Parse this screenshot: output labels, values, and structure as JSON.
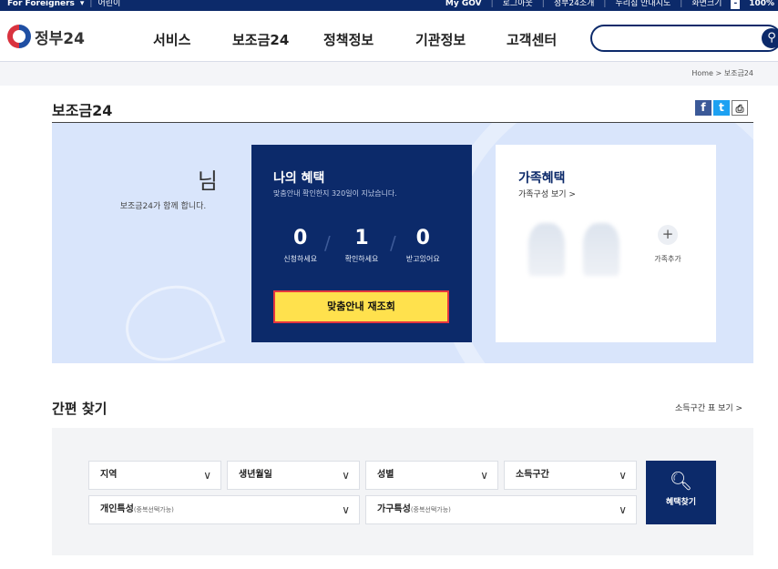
{
  "topbar": {
    "foreigners": "For Foreigners",
    "language": "어린이",
    "links": [
      "My GOV",
      "로그아웃",
      "정부24소개",
      "누리집 안내지도",
      "화면크기"
    ],
    "zoom": "100%"
  },
  "header": {
    "logo_text": "정부24",
    "nav": [
      "서비스",
      "보조금24",
      "정책정보",
      "기관정보",
      "고객센터"
    ],
    "search_placeholder": ""
  },
  "breadcrumb": "Home > 보조금24",
  "page": {
    "title": "보조금24"
  },
  "greeting": {
    "name_suffix": "님",
    "subtitle": "보조금24가 함께 합니다."
  },
  "my_benefits": {
    "title": "나의 혜택",
    "info": "맞춤안내 확인한지 320일이 지났습니다.",
    "counts": [
      {
        "value": "0",
        "label": "신청하세요"
      },
      {
        "value": "1",
        "label": "확인하세요"
      },
      {
        "value": "0",
        "label": "받고있어요"
      }
    ],
    "recheck_label": "맞춤안내 재조회"
  },
  "family": {
    "title": "가족혜택",
    "link": "가족구성 보기 >",
    "add_label": "가족추가"
  },
  "quick_search": {
    "title": "간편 찾기",
    "income_link": "소득구간 표 보기 >",
    "selects": {
      "region": "지역",
      "birth": "생년월일",
      "gender": "성별",
      "income": "소득구간"
    },
    "personal": {
      "label": "개인특성",
      "hint": "(중복선택가능)"
    },
    "household": {
      "label": "가구특성",
      "hint": "(중복선택가능)"
    },
    "find_label": "혜택찾기"
  }
}
